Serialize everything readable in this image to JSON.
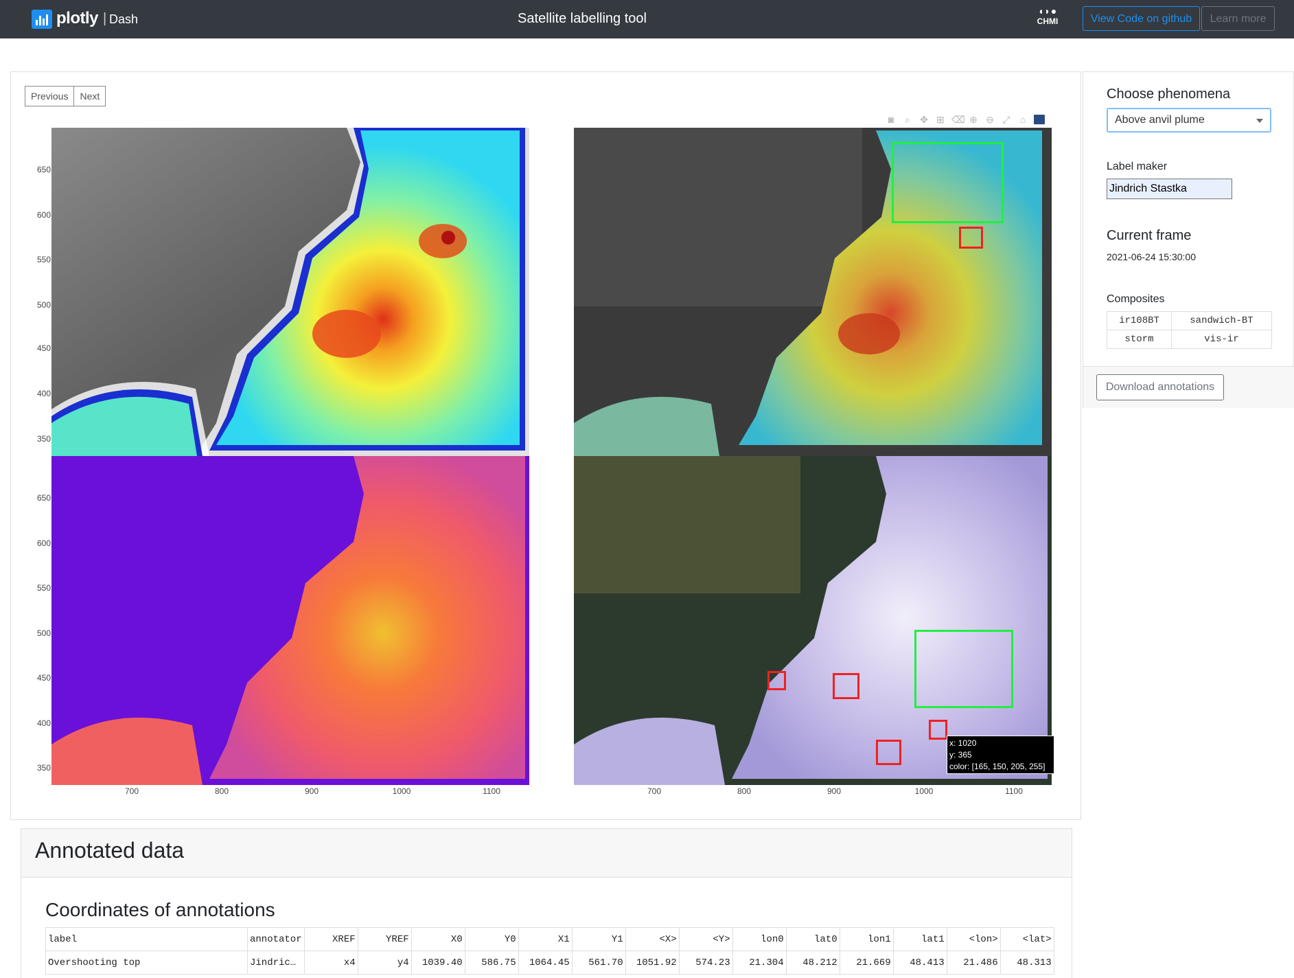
{
  "navbar": {
    "brand": "plotly",
    "separator": "|",
    "product": "Dash",
    "title": "Satellite labelling tool",
    "org_logo_text": "CHMI",
    "github_button": "View Code on github",
    "learn_button": "Learn more"
  },
  "pager": {
    "previous": "Previous",
    "next": "Next"
  },
  "modebar_icons": [
    "camera-icon",
    "zoom-icon",
    "pan-icon",
    "box-select-icon",
    "erase-icon",
    "zoom-in-icon",
    "zoom-out-icon",
    "autoscale-icon",
    "reset-axes-icon",
    "plotly-logo-icon"
  ],
  "axes": {
    "y_ticks": [
      "650",
      "600",
      "550",
      "500",
      "450",
      "400",
      "350"
    ],
    "x_ticks": [
      "700",
      "800",
      "900",
      "1000",
      "1100"
    ]
  },
  "panels": [
    "ir108BT",
    "sandwich-BT",
    "storm",
    "vis-ir"
  ],
  "hover_tooltip": {
    "x": "x: 1020",
    "y": "y: 365",
    "color": "color: [165, 150, 205, 255]"
  },
  "sidebar": {
    "phenomena_heading": "Choose phenomena",
    "phenomena_value": "Above anvil plume",
    "label_maker_heading": "Label maker",
    "label_maker_value": "Jindrich Stastka",
    "frame_heading": "Current frame",
    "frame_value": "2021-06-24 15:30:00",
    "composites_heading": "Composites",
    "composites": [
      [
        "ir108BT",
        "sandwich-BT"
      ],
      [
        "storm",
        "vis-ir"
      ]
    ],
    "download_button": "Download annotations"
  },
  "annotated": {
    "title": "Annotated data",
    "coords_title": "Coordinates of annotations",
    "columns": [
      "label",
      "annotator",
      "XREF",
      "YREF",
      "X0",
      "Y0",
      "X1",
      "Y1",
      "<X>",
      "<Y>",
      "lon0",
      "lat0",
      "lon1",
      "lat1",
      "<lon>",
      "<lat>"
    ],
    "rows": [
      [
        "Overshooting top",
        "Jindric…",
        "x4",
        "y4",
        "1039.40",
        "586.75",
        "1064.45",
        "561.70",
        "1051.92",
        "574.23",
        "21.304",
        "48.212",
        "21.669",
        "48.413",
        "21.486",
        "48.313"
      ]
    ]
  },
  "colors": {
    "navbar_bg": "#343a40",
    "accent": "#1f8ef1",
    "annotation_green": "#22ee44",
    "annotation_red": "#ee2222"
  }
}
